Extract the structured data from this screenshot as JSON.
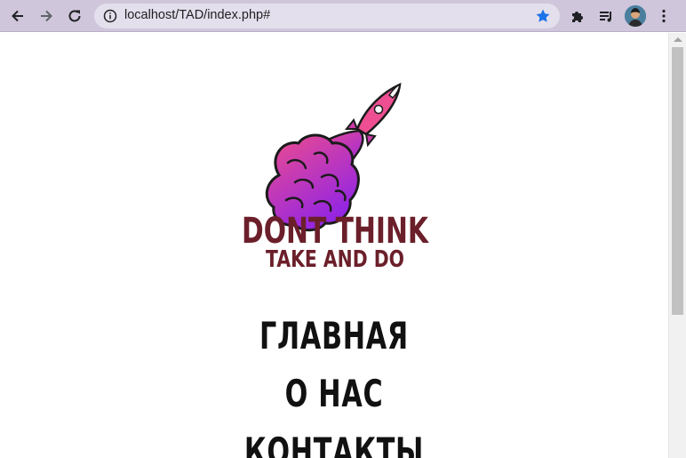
{
  "browser": {
    "url": "localhost/TAD/index.php#",
    "icons": [
      "back-icon",
      "forward-icon",
      "reload-icon",
      "info-icon",
      "star-icon",
      "extensions-icon",
      "media-queue-icon",
      "menu-icon"
    ]
  },
  "logo": {
    "line1": "DONT THINK",
    "line2": "TAKE AND DO",
    "text_color": "#6b1f2a",
    "gradient": [
      "#e94a8f",
      "#9b27e0"
    ]
  },
  "nav": {
    "items": [
      "ГЛАВНАЯ",
      "О НАС",
      "КОНТАКТЫ"
    ]
  }
}
